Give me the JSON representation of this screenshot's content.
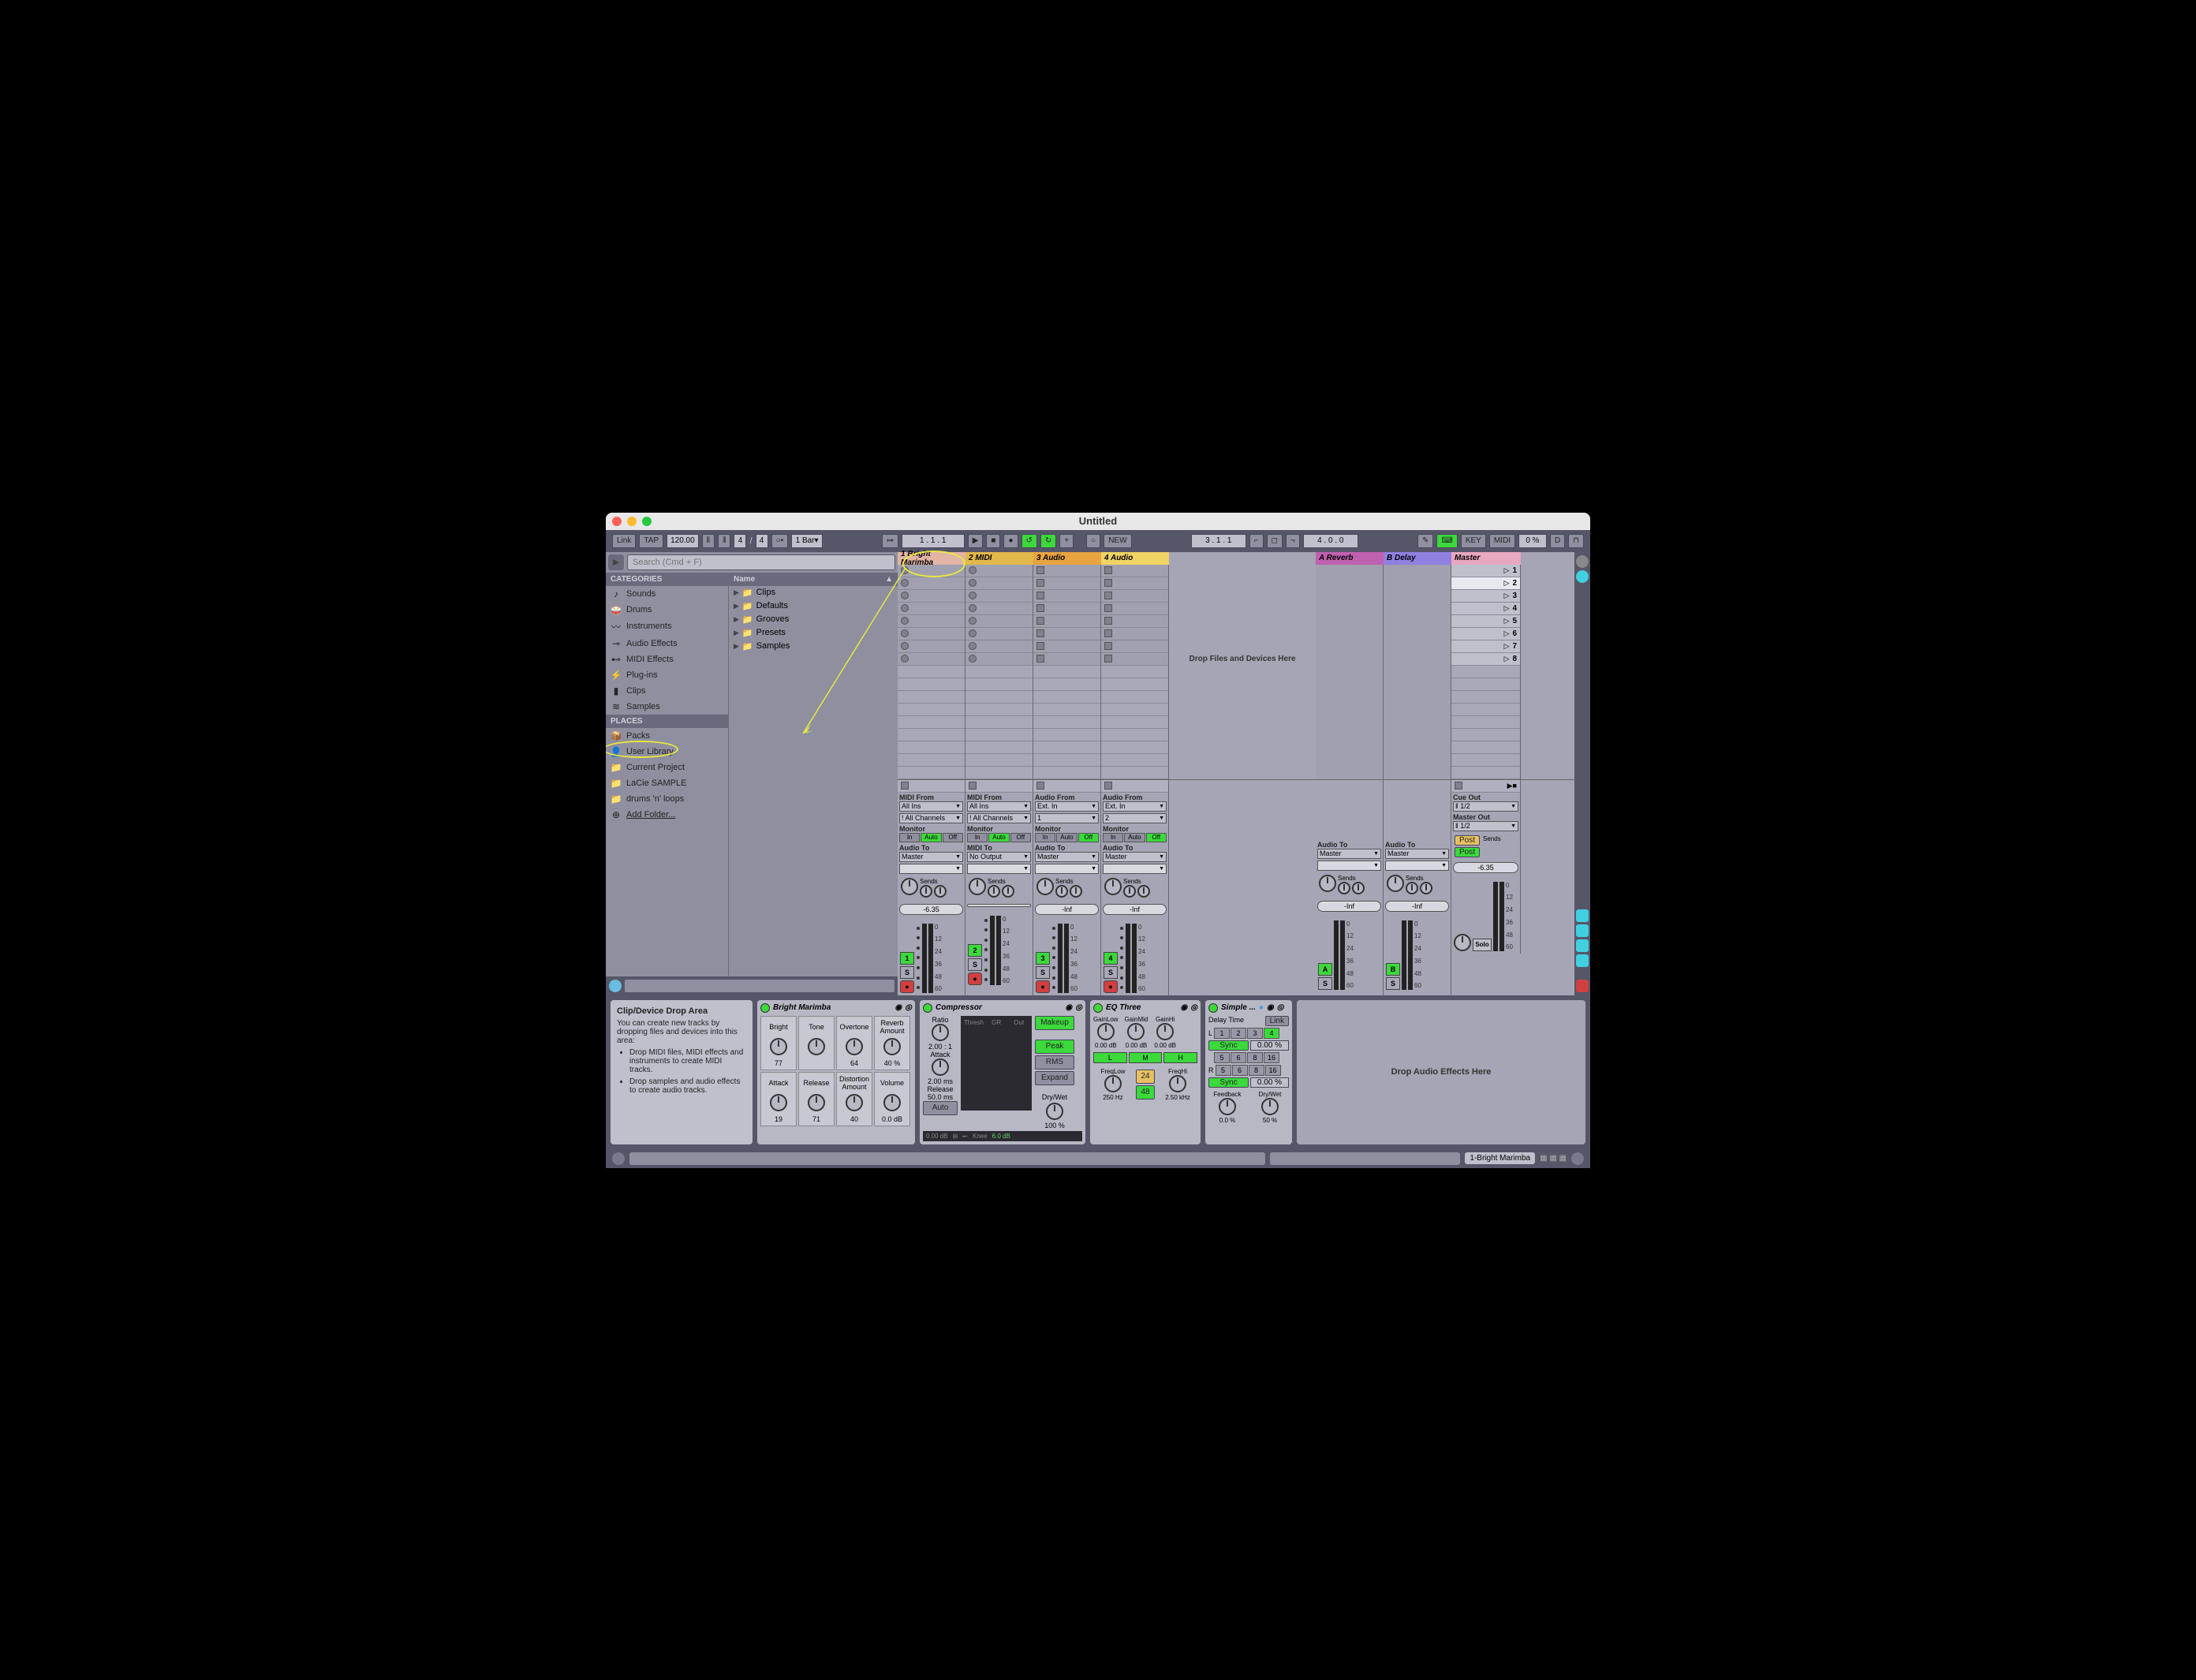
{
  "window": {
    "title": "Untitled"
  },
  "toolbar": {
    "link": "Link",
    "tap": "TAP",
    "tempo": "120.00",
    "sig_num": "4",
    "sig_den": "4",
    "quantize": "1 Bar",
    "position": "1 .  1 .  1",
    "position2": "3 .  1 .  1",
    "new": "NEW",
    "key": "KEY",
    "midi": "MIDI",
    "pct": "0 %",
    "d": "D",
    "bars2": "4 .   0 .   0"
  },
  "browser": {
    "search_placeholder": "Search (Cmd + F)",
    "categories_header": "CATEGORIES",
    "categories": [
      {
        "icon": "♪",
        "label": "Sounds"
      },
      {
        "icon": "🥁",
        "label": "Drums"
      },
      {
        "icon": "〰",
        "label": "Instruments"
      },
      {
        "icon": "⊸",
        "label": "Audio Effects"
      },
      {
        "icon": "⊷",
        "label": "MIDI Effects"
      },
      {
        "icon": "⚡",
        "label": "Plug-ins"
      },
      {
        "icon": "▮",
        "label": "Clips"
      },
      {
        "icon": "≋",
        "label": "Samples"
      }
    ],
    "places_header": "PLACES",
    "places": [
      {
        "icon": "📦",
        "label": "Packs"
      },
      {
        "icon": "👤",
        "label": "User Library"
      },
      {
        "icon": "📁",
        "label": "Current Project"
      },
      {
        "icon": "📁",
        "label": "LaCie SAMPLE"
      },
      {
        "icon": "📁",
        "label": "drums 'n' loops"
      },
      {
        "icon": "⊕",
        "label": "Add Folder..."
      }
    ],
    "name_header": "Name",
    "tree": [
      "Clips",
      "Defaults",
      "Grooves",
      "Presets",
      "Samples"
    ]
  },
  "tracks": [
    {
      "name": "1 Bright Marimba",
      "cls": "th1"
    },
    {
      "name": "2 MIDI",
      "cls": "th2"
    },
    {
      "name": "3 Audio",
      "cls": "th3"
    },
    {
      "name": "4 Audio",
      "cls": "th4"
    }
  ],
  "returns": [
    {
      "name": "A Reverb",
      "cls": "thR"
    },
    {
      "name": "B Delay",
      "cls": "thD"
    }
  ],
  "master": {
    "name": "Master",
    "cls": "thM"
  },
  "scenes": [
    1,
    2,
    3,
    4,
    5,
    6,
    7,
    8
  ],
  "drop_zone": "Drop Files and Devices Here",
  "io": {
    "midi_from": "MIDI From",
    "audio_from": "Audio From",
    "all_ins": "All Ins",
    "ext_in": "Ext. In",
    "all_channels": "All Channels",
    "ch1": "1",
    "ch2": "2",
    "monitor": "Monitor",
    "in": "In",
    "auto": "Auto",
    "off": "Off",
    "midi_to": "MIDI To",
    "audio_to": "Audio To",
    "master": "Master",
    "no_output": "No Output",
    "cue_out": "Cue Out",
    "master_out": "Master Out",
    "out12": "1/2",
    "sends": "Sends",
    "post": "Post",
    "solo": "Solo"
  },
  "mixer": {
    "vol1": "-6.35",
    "vol_inf": "-Inf",
    "vol_master": "-6.35",
    "scale": [
      "0",
      "12",
      "24",
      "36",
      "48",
      "60"
    ],
    "s": "S",
    "a": "A",
    "b": "B",
    "t1": "1",
    "t2": "2",
    "t3": "3",
    "t4": "4"
  },
  "info_panel": {
    "title": "Clip/Device Drop Area",
    "intro": "You can create new tracks by dropping files and devices into this area:",
    "b1": "Drop MIDI files, MIDI effects and instruments to create MIDI tracks.",
    "b2": "Drop samples and audio effects to create audio tracks."
  },
  "devices": {
    "marimba": {
      "title": "Bright Marimba",
      "row1": [
        {
          "l": "Bright",
          "v": "77"
        },
        {
          "l": "Tone",
          "v": ""
        },
        {
          "l": "Overtone",
          "v": "64"
        },
        {
          "l": "Reverb Amount",
          "v": "40 %"
        }
      ],
      "row2": [
        {
          "l": "Attack",
          "v": "19"
        },
        {
          "l": "Release",
          "v": "71"
        },
        {
          "l": "Distortion Amount",
          "v": "40"
        },
        {
          "l": "Volume",
          "v": "0.0 dB"
        }
      ]
    },
    "compressor": {
      "title": "Compressor",
      "ratio": "Ratio",
      "ratio_v": "2.00 : 1",
      "attack": "Attack",
      "attack_v": "2.00 ms",
      "release": "Release",
      "release_v": "50.0 ms",
      "auto": "Auto",
      "thresh": "Thresh",
      "gr": "GR",
      "out": "Out",
      "makeup": "Makeup",
      "peak": "Peak",
      "rms": "RMS",
      "expand": "Expand",
      "drywet": "Dry/Wet",
      "drywet_v": "100 %",
      "out_db": "0.00 dB",
      "knee": "Knee",
      "knee_v": "6.0 dB"
    },
    "eq": {
      "title": "EQ Three",
      "gainlow": "GainLow",
      "gainmid": "GainMid",
      "gainhi": "GainHi",
      "db": "0.00 dB",
      "l": "L",
      "m": "M",
      "h": "H",
      "freqlow": "FreqLow",
      "freqlow_v": "250 Hz",
      "freqhi": "FreqHi",
      "freqhi_v": "2.50 kHz",
      "v24": "24",
      "v48": "48"
    },
    "delay": {
      "title": "Simple ...",
      "delay_time": "Delay Time",
      "link": "Link",
      "l": "L",
      "r": "R",
      "sync": "Sync",
      "pct": "0.00 %",
      "nums": [
        "1",
        "2",
        "3",
        "4",
        "5",
        "6",
        "8",
        "16"
      ],
      "feedback": "Feedback",
      "feedback_v": "0.0 %",
      "drywet": "Dry/Wet",
      "drywet_v": "50 %"
    },
    "drop_fx": "Drop Audio Effects Here"
  },
  "statusbar": {
    "track": "1-Bright Marimba"
  }
}
